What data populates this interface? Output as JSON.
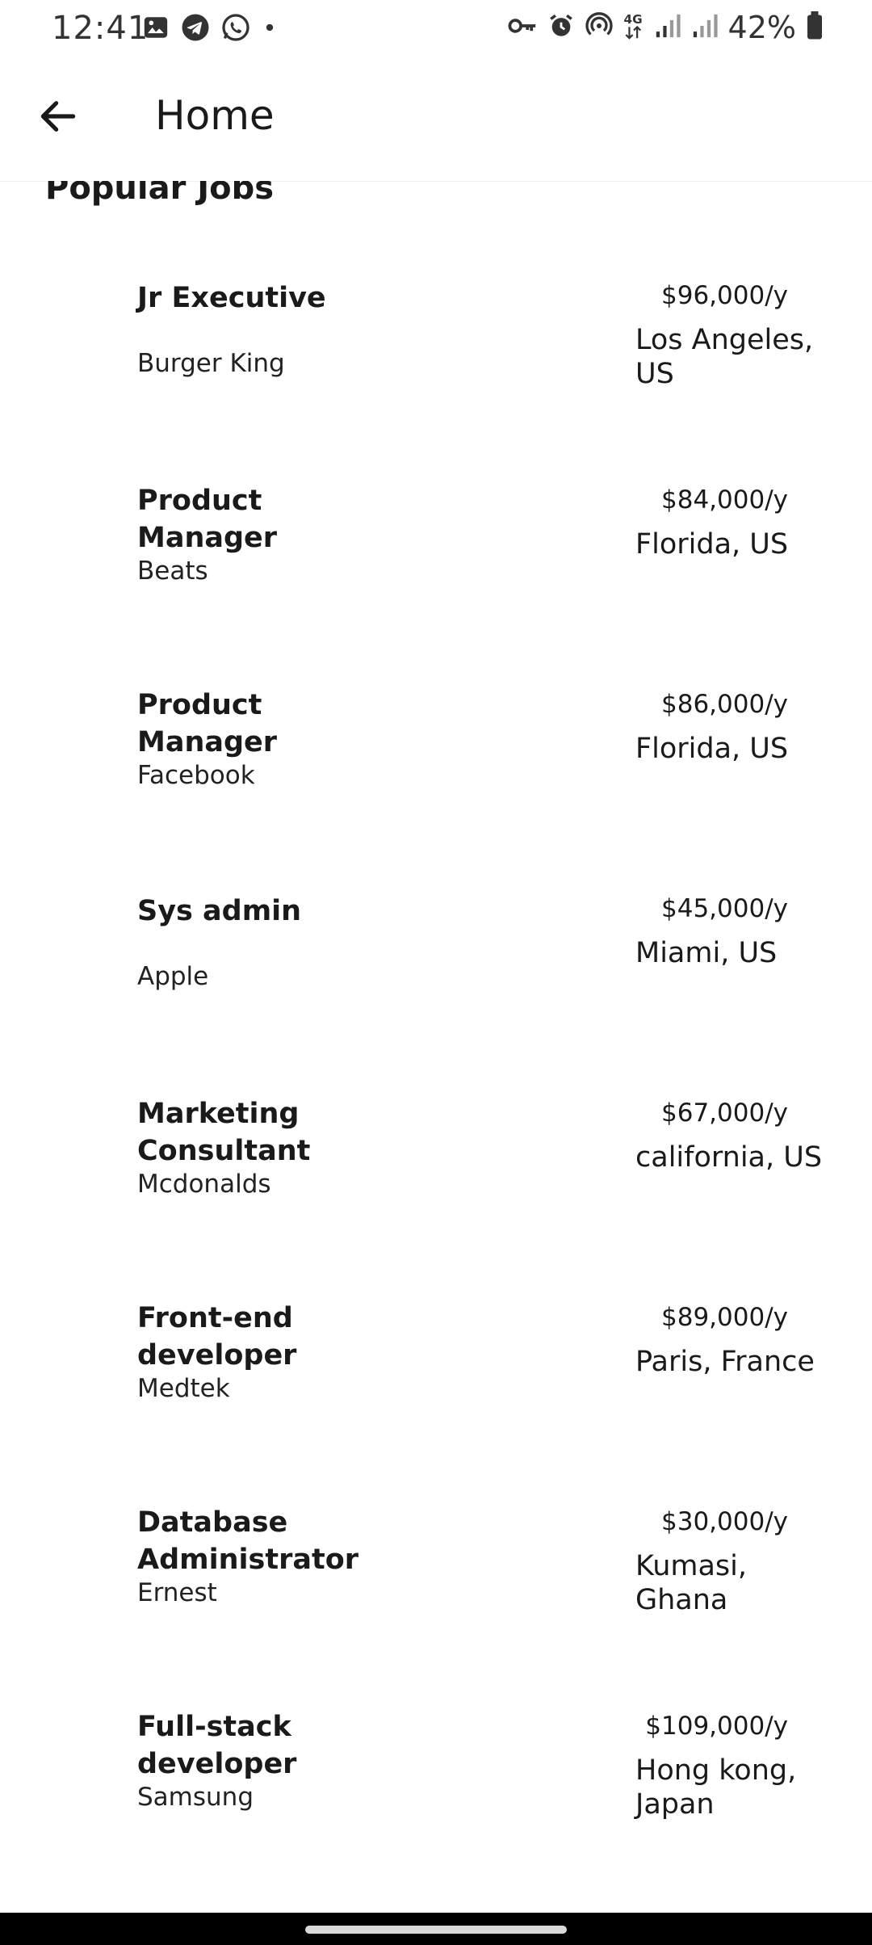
{
  "status_bar": {
    "time": "12:41",
    "battery_percent": "42%",
    "left_icons": [
      "gallery-icon",
      "telegram-icon",
      "whatsapp-icon",
      "dot-icon"
    ],
    "right_icons": [
      "key-icon",
      "alarm-icon",
      "hotspot-icon",
      "4g-icon",
      "signal-icon",
      "signal-icon",
      "battery-icon"
    ]
  },
  "app_bar": {
    "title": "Home",
    "back_icon": "arrow-back-icon"
  },
  "section": {
    "title": "Popular Jobs"
  },
  "jobs": [
    {
      "title": "Jr Executive",
      "company": "Burger King",
      "salary": "$96,000/y",
      "location": "Los Angeles, US"
    },
    {
      "title": "Product Manager",
      "company": "Beats",
      "salary": "$84,000/y",
      "location": "Florida, US"
    },
    {
      "title": "Product Manager",
      "company": "Facebook",
      "salary": "$86,000/y",
      "location": "Florida, US"
    },
    {
      "title": "Sys admin",
      "company": "Apple",
      "salary": "$45,000/y",
      "location": "Miami, US"
    },
    {
      "title": "Marketing Consultant",
      "company": "Mcdonalds",
      "salary": "$67,000/y",
      "location": "california, US"
    },
    {
      "title": "Front-end developer",
      "company": "Medtek",
      "salary": "$89,000/y",
      "location": "Paris, France"
    },
    {
      "title": "Database Administrator",
      "company": "Ernest",
      "salary": "$30,000/y",
      "location": "Kumasi, Ghana"
    },
    {
      "title": "Full-stack developer",
      "company": "Samsung",
      "salary": "$109,000/y",
      "location": "Hong kong, Japan"
    }
  ]
}
